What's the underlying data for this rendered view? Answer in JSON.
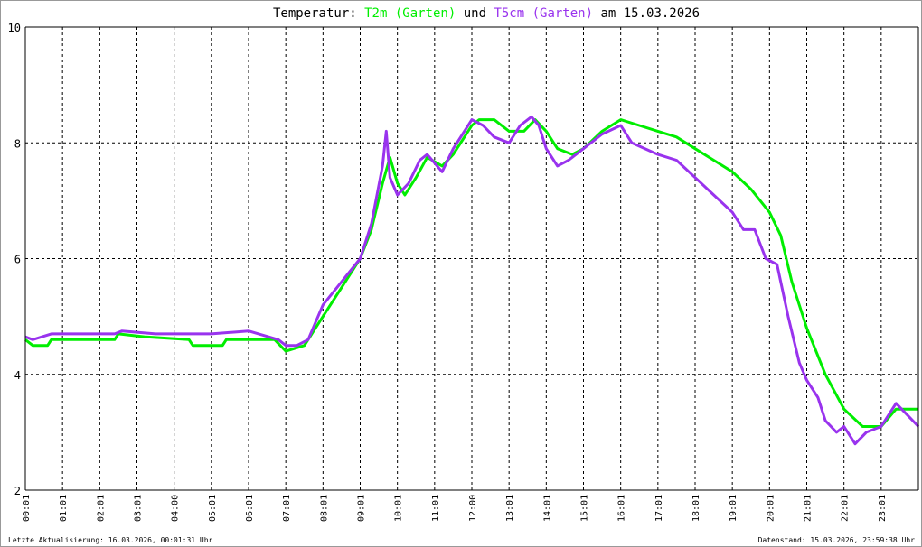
{
  "title": {
    "prefix": "Temperatur: ",
    "s1": "T2m (Garten)",
    "mid": " und ",
    "s2": "T5cm (Garten)",
    "suffix": " am 15.03.2026"
  },
  "footer": {
    "left": "Letzte Aktualisierung: 16.03.2026, 00:01:31 Uhr",
    "right": "Datenstand: 15.03.2026, 23:59:38 Uhr"
  },
  "chart_data": {
    "type": "line",
    "title": "Temperatur: T2m (Garten) und T5cm (Garten) am 15.03.2026",
    "xlabel": "",
    "ylabel": "",
    "xlim": [
      0,
      24
    ],
    "ylim": [
      2,
      10
    ],
    "yticks": [
      2,
      4,
      6,
      8,
      10
    ],
    "xticks": [
      {
        "h": 0,
        "label": "00:01"
      },
      {
        "h": 1,
        "label": "01:01"
      },
      {
        "h": 2,
        "label": "02:01"
      },
      {
        "h": 3,
        "label": "03:01"
      },
      {
        "h": 4,
        "label": "04:00"
      },
      {
        "h": 5,
        "label": "05:01"
      },
      {
        "h": 6,
        "label": "06:01"
      },
      {
        "h": 7,
        "label": "07:01"
      },
      {
        "h": 8,
        "label": "08:01"
      },
      {
        "h": 9,
        "label": "09:01"
      },
      {
        "h": 10,
        "label": "10:01"
      },
      {
        "h": 11,
        "label": "11:01"
      },
      {
        "h": 12,
        "label": "12:00"
      },
      {
        "h": 13,
        "label": "13:01"
      },
      {
        "h": 14,
        "label": "14:01"
      },
      {
        "h": 15,
        "label": "15:01"
      },
      {
        "h": 16,
        "label": "16:01"
      },
      {
        "h": 17,
        "label": "17:01"
      },
      {
        "h": 18,
        "label": "18:01"
      },
      {
        "h": 19,
        "label": "19:01"
      },
      {
        "h": 20,
        "label": "20:01"
      },
      {
        "h": 21,
        "label": "21:01"
      },
      {
        "h": 22,
        "label": "22:01"
      },
      {
        "h": 23,
        "label": "23:01"
      }
    ],
    "grid": true,
    "series": [
      {
        "name": "T2m (Garten)",
        "color": "#00ee00",
        "points": [
          [
            0,
            4.6
          ],
          [
            0.2,
            4.5
          ],
          [
            0.6,
            4.5
          ],
          [
            0.7,
            4.6
          ],
          [
            2.4,
            4.6
          ],
          [
            2.5,
            4.7
          ],
          [
            3.2,
            4.65
          ],
          [
            4.4,
            4.6
          ],
          [
            4.5,
            4.5
          ],
          [
            5.3,
            4.5
          ],
          [
            5.4,
            4.6
          ],
          [
            6.7,
            4.6
          ],
          [
            7.0,
            4.4
          ],
          [
            7.5,
            4.5
          ],
          [
            8.0,
            5.0
          ],
          [
            8.5,
            5.5
          ],
          [
            9.0,
            6.0
          ],
          [
            9.3,
            6.5
          ],
          [
            9.6,
            7.3
          ],
          [
            9.8,
            7.75
          ],
          [
            10.0,
            7.3
          ],
          [
            10.2,
            7.1
          ],
          [
            10.5,
            7.4
          ],
          [
            10.8,
            7.75
          ],
          [
            11.2,
            7.6
          ],
          [
            11.5,
            7.8
          ],
          [
            12.0,
            8.3
          ],
          [
            12.2,
            8.4
          ],
          [
            12.6,
            8.4
          ],
          [
            13.0,
            8.2
          ],
          [
            13.4,
            8.2
          ],
          [
            13.7,
            8.4
          ],
          [
            14.0,
            8.2
          ],
          [
            14.3,
            7.9
          ],
          [
            14.7,
            7.8
          ],
          [
            15.0,
            7.9
          ],
          [
            15.5,
            8.2
          ],
          [
            16.0,
            8.4
          ],
          [
            16.5,
            8.3
          ],
          [
            17.0,
            8.2
          ],
          [
            17.5,
            8.1
          ],
          [
            18.0,
            7.9
          ],
          [
            18.5,
            7.7
          ],
          [
            19.0,
            7.5
          ],
          [
            19.5,
            7.2
          ],
          [
            20.0,
            6.8
          ],
          [
            20.3,
            6.4
          ],
          [
            20.6,
            5.6
          ],
          [
            21.0,
            4.8
          ],
          [
            21.5,
            4.0
          ],
          [
            22.0,
            3.4
          ],
          [
            22.5,
            3.1
          ],
          [
            23.0,
            3.1
          ],
          [
            23.4,
            3.4
          ],
          [
            24,
            3.4
          ]
        ]
      },
      {
        "name": "T5cm (Garten)",
        "color": "#9933ee",
        "points": [
          [
            0,
            4.65
          ],
          [
            0.2,
            4.6
          ],
          [
            0.7,
            4.7
          ],
          [
            2.4,
            4.7
          ],
          [
            2.6,
            4.75
          ],
          [
            3.5,
            4.7
          ],
          [
            4.5,
            4.7
          ],
          [
            5.0,
            4.7
          ],
          [
            6.0,
            4.75
          ],
          [
            6.8,
            4.6
          ],
          [
            7.0,
            4.5
          ],
          [
            7.3,
            4.5
          ],
          [
            7.6,
            4.6
          ],
          [
            8.0,
            5.2
          ],
          [
            8.5,
            5.6
          ],
          [
            9.0,
            6.0
          ],
          [
            9.3,
            6.6
          ],
          [
            9.6,
            7.6
          ],
          [
            9.7,
            8.2
          ],
          [
            9.8,
            7.4
          ],
          [
            10.0,
            7.1
          ],
          [
            10.3,
            7.3
          ],
          [
            10.6,
            7.7
          ],
          [
            10.8,
            7.8
          ],
          [
            11.2,
            7.5
          ],
          [
            11.5,
            7.9
          ],
          [
            12.0,
            8.4
          ],
          [
            12.3,
            8.3
          ],
          [
            12.6,
            8.1
          ],
          [
            13.0,
            8.0
          ],
          [
            13.3,
            8.3
          ],
          [
            13.6,
            8.45
          ],
          [
            13.8,
            8.3
          ],
          [
            14.0,
            7.9
          ],
          [
            14.3,
            7.6
          ],
          [
            14.6,
            7.7
          ],
          [
            15.0,
            7.9
          ],
          [
            15.5,
            8.15
          ],
          [
            16.0,
            8.3
          ],
          [
            16.3,
            8.0
          ],
          [
            17.0,
            7.8
          ],
          [
            17.5,
            7.7
          ],
          [
            18.0,
            7.4
          ],
          [
            18.5,
            7.1
          ],
          [
            19.0,
            6.8
          ],
          [
            19.3,
            6.5
          ],
          [
            19.6,
            6.5
          ],
          [
            19.9,
            6.0
          ],
          [
            20.2,
            5.9
          ],
          [
            20.5,
            5.0
          ],
          [
            20.8,
            4.2
          ],
          [
            21.0,
            3.9
          ],
          [
            21.3,
            3.6
          ],
          [
            21.5,
            3.2
          ],
          [
            21.8,
            3.0
          ],
          [
            22.0,
            3.1
          ],
          [
            22.3,
            2.8
          ],
          [
            22.6,
            3.0
          ],
          [
            23.0,
            3.1
          ],
          [
            23.4,
            3.5
          ],
          [
            23.7,
            3.3
          ],
          [
            24,
            3.1
          ]
        ]
      }
    ]
  }
}
